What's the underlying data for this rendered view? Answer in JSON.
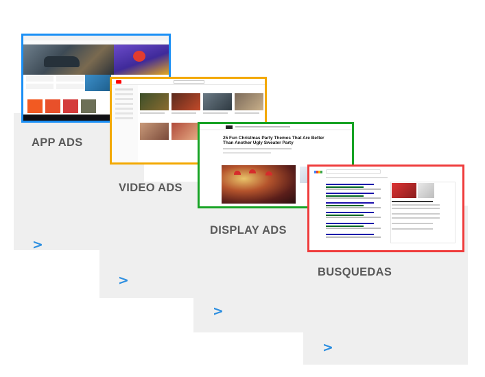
{
  "steps": {
    "app": {
      "label": "APP ADS",
      "chevron": ">",
      "border_color": "#1a8ff5"
    },
    "video": {
      "label": "VIDEO ADS",
      "chevron": ">",
      "border_color": "#f3a800"
    },
    "display": {
      "label": "DISPLAY ADS",
      "chevron": ">",
      "border_color": "#17a324"
    },
    "search": {
      "label": "BUSQUEDAS",
      "chevron": ">",
      "border_color": "#ef3b3b"
    }
  },
  "display_article": {
    "headline": "25 Fun Christmas Party Themes That Are Better Than Another Ugly Sweater Party"
  },
  "colors": {
    "step_bg": "#efefef",
    "label": "#595959",
    "chevron": "#2e8fe0"
  }
}
